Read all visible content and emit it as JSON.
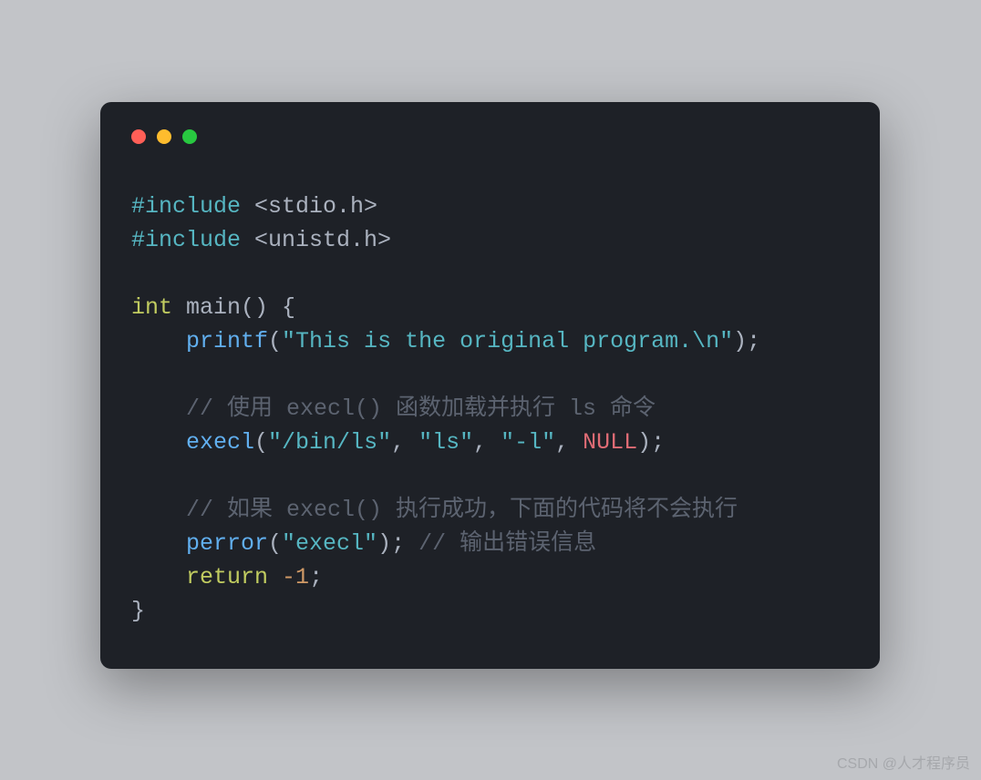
{
  "colors": {
    "page_bg": "#c2c4c8",
    "window_bg": "#1e2127",
    "dot_red": "#ff5f57",
    "dot_yellow": "#febc2e",
    "dot_green": "#28c840",
    "text_default": "#abb2bf",
    "preproc": "#56b6c2",
    "keyword": "#c1cc60",
    "type": "#c1cc60",
    "func": "#61afef",
    "string": "#56b6c2",
    "number": "#d19a66",
    "null": "#e06c75",
    "comment": "#5c6370",
    "watermark": "#a6a8ac"
  },
  "code": {
    "line1": {
      "preproc": "#include",
      "header": " <stdio.h>"
    },
    "line2": {
      "preproc": "#include",
      "header": " <unistd.h>"
    },
    "blank1": "",
    "line3": {
      "type": "int",
      "ident": " main",
      "open": "() {"
    },
    "line4": {
      "indent": "    ",
      "func": "printf",
      "open": "(",
      "str": "\"This is the original program.\\n\"",
      "close": ");"
    },
    "blank2": "",
    "line5": {
      "indent": "    ",
      "comment": "// 使用 execl() 函数加载并执行 ls 命令"
    },
    "line6": {
      "indent": "    ",
      "func": "execl",
      "open": "(",
      "s1": "\"/bin/ls\"",
      "c1": ", ",
      "s2": "\"ls\"",
      "c2": ", ",
      "s3": "\"-l\"",
      "c3": ", ",
      "null": "NULL",
      "close": ");"
    },
    "blank3": "",
    "line7": {
      "indent": "    ",
      "comment": "// 如果 execl() 执行成功，下面的代码将不会执行"
    },
    "line8": {
      "indent": "    ",
      "func": "perror",
      "open": "(",
      "str": "\"execl\"",
      "close": "); ",
      "comment": "// 输出错误信息"
    },
    "line9": {
      "indent": "    ",
      "keyword": "return",
      "sp": " ",
      "num": "-1",
      "semi": ";"
    },
    "line10": {
      "brace": "}"
    }
  },
  "watermark": "CSDN @人才程序员"
}
